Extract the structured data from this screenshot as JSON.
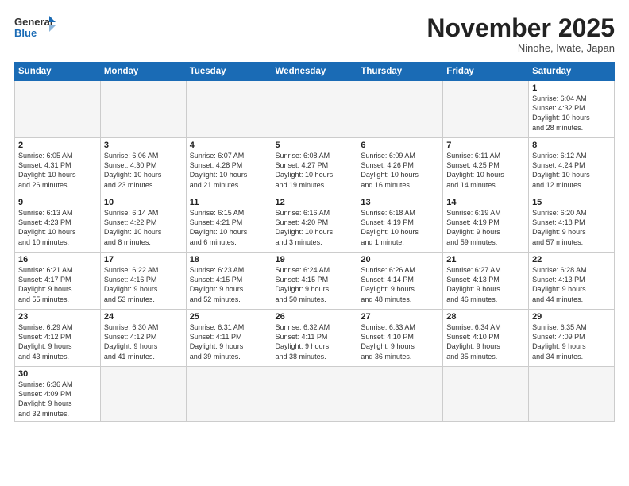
{
  "header": {
    "logo_general": "General",
    "logo_blue": "Blue",
    "month_title": "November 2025",
    "location": "Ninohe, Iwate, Japan"
  },
  "days_of_week": [
    "Sunday",
    "Monday",
    "Tuesday",
    "Wednesday",
    "Thursday",
    "Friday",
    "Saturday"
  ],
  "weeks": [
    [
      {
        "day": "",
        "info": ""
      },
      {
        "day": "",
        "info": ""
      },
      {
        "day": "",
        "info": ""
      },
      {
        "day": "",
        "info": ""
      },
      {
        "day": "",
        "info": ""
      },
      {
        "day": "",
        "info": ""
      },
      {
        "day": "1",
        "info": "Sunrise: 6:04 AM\nSunset: 4:32 PM\nDaylight: 10 hours\nand 28 minutes."
      }
    ],
    [
      {
        "day": "2",
        "info": "Sunrise: 6:05 AM\nSunset: 4:31 PM\nDaylight: 10 hours\nand 26 minutes."
      },
      {
        "day": "3",
        "info": "Sunrise: 6:06 AM\nSunset: 4:30 PM\nDaylight: 10 hours\nand 23 minutes."
      },
      {
        "day": "4",
        "info": "Sunrise: 6:07 AM\nSunset: 4:28 PM\nDaylight: 10 hours\nand 21 minutes."
      },
      {
        "day": "5",
        "info": "Sunrise: 6:08 AM\nSunset: 4:27 PM\nDaylight: 10 hours\nand 19 minutes."
      },
      {
        "day": "6",
        "info": "Sunrise: 6:09 AM\nSunset: 4:26 PM\nDaylight: 10 hours\nand 16 minutes."
      },
      {
        "day": "7",
        "info": "Sunrise: 6:11 AM\nSunset: 4:25 PM\nDaylight: 10 hours\nand 14 minutes."
      },
      {
        "day": "8",
        "info": "Sunrise: 6:12 AM\nSunset: 4:24 PM\nDaylight: 10 hours\nand 12 minutes."
      }
    ],
    [
      {
        "day": "9",
        "info": "Sunrise: 6:13 AM\nSunset: 4:23 PM\nDaylight: 10 hours\nand 10 minutes."
      },
      {
        "day": "10",
        "info": "Sunrise: 6:14 AM\nSunset: 4:22 PM\nDaylight: 10 hours\nand 8 minutes."
      },
      {
        "day": "11",
        "info": "Sunrise: 6:15 AM\nSunset: 4:21 PM\nDaylight: 10 hours\nand 6 minutes."
      },
      {
        "day": "12",
        "info": "Sunrise: 6:16 AM\nSunset: 4:20 PM\nDaylight: 10 hours\nand 3 minutes."
      },
      {
        "day": "13",
        "info": "Sunrise: 6:18 AM\nSunset: 4:19 PM\nDaylight: 10 hours\nand 1 minute."
      },
      {
        "day": "14",
        "info": "Sunrise: 6:19 AM\nSunset: 4:19 PM\nDaylight: 9 hours\nand 59 minutes."
      },
      {
        "day": "15",
        "info": "Sunrise: 6:20 AM\nSunset: 4:18 PM\nDaylight: 9 hours\nand 57 minutes."
      }
    ],
    [
      {
        "day": "16",
        "info": "Sunrise: 6:21 AM\nSunset: 4:17 PM\nDaylight: 9 hours\nand 55 minutes."
      },
      {
        "day": "17",
        "info": "Sunrise: 6:22 AM\nSunset: 4:16 PM\nDaylight: 9 hours\nand 53 minutes."
      },
      {
        "day": "18",
        "info": "Sunrise: 6:23 AM\nSunset: 4:15 PM\nDaylight: 9 hours\nand 52 minutes."
      },
      {
        "day": "19",
        "info": "Sunrise: 6:24 AM\nSunset: 4:15 PM\nDaylight: 9 hours\nand 50 minutes."
      },
      {
        "day": "20",
        "info": "Sunrise: 6:26 AM\nSunset: 4:14 PM\nDaylight: 9 hours\nand 48 minutes."
      },
      {
        "day": "21",
        "info": "Sunrise: 6:27 AM\nSunset: 4:13 PM\nDaylight: 9 hours\nand 46 minutes."
      },
      {
        "day": "22",
        "info": "Sunrise: 6:28 AM\nSunset: 4:13 PM\nDaylight: 9 hours\nand 44 minutes."
      }
    ],
    [
      {
        "day": "23",
        "info": "Sunrise: 6:29 AM\nSunset: 4:12 PM\nDaylight: 9 hours\nand 43 minutes."
      },
      {
        "day": "24",
        "info": "Sunrise: 6:30 AM\nSunset: 4:12 PM\nDaylight: 9 hours\nand 41 minutes."
      },
      {
        "day": "25",
        "info": "Sunrise: 6:31 AM\nSunset: 4:11 PM\nDaylight: 9 hours\nand 39 minutes."
      },
      {
        "day": "26",
        "info": "Sunrise: 6:32 AM\nSunset: 4:11 PM\nDaylight: 9 hours\nand 38 minutes."
      },
      {
        "day": "27",
        "info": "Sunrise: 6:33 AM\nSunset: 4:10 PM\nDaylight: 9 hours\nand 36 minutes."
      },
      {
        "day": "28",
        "info": "Sunrise: 6:34 AM\nSunset: 4:10 PM\nDaylight: 9 hours\nand 35 minutes."
      },
      {
        "day": "29",
        "info": "Sunrise: 6:35 AM\nSunset: 4:09 PM\nDaylight: 9 hours\nand 34 minutes."
      }
    ],
    [
      {
        "day": "30",
        "info": "Sunrise: 6:36 AM\nSunset: 4:09 PM\nDaylight: 9 hours\nand 32 minutes."
      },
      {
        "day": "",
        "info": ""
      },
      {
        "day": "",
        "info": ""
      },
      {
        "day": "",
        "info": ""
      },
      {
        "day": "",
        "info": ""
      },
      {
        "day": "",
        "info": ""
      },
      {
        "day": "",
        "info": ""
      }
    ]
  ]
}
